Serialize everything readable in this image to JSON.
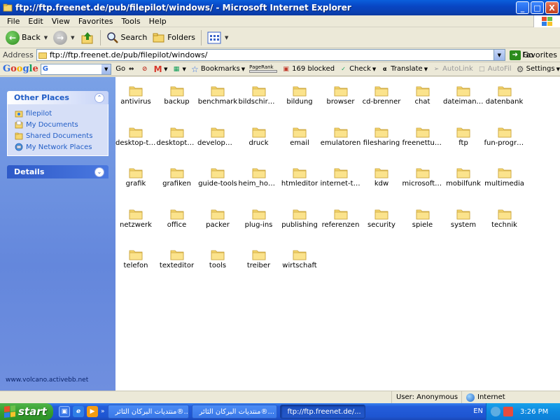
{
  "window": {
    "title": "ftp://ftp.freenet.de/pub/filepilot/windows/ - Microsoft Internet Explorer",
    "minimize": "_",
    "maximize": "□",
    "close": "X"
  },
  "menu": [
    "File",
    "Edit",
    "View",
    "Favorites",
    "Tools",
    "Help"
  ],
  "toolbar": {
    "back_label": "Back",
    "search_label": "Search",
    "folders_label": "Folders"
  },
  "address": {
    "label": "Address",
    "value": "ftp://ftp.freenet.de/pub/filepilot/windows/",
    "go_label": "Go",
    "favorites_label": "Favorites"
  },
  "google_toolbar": {
    "logo": "Google",
    "search_value": "G",
    "go_label": "Go",
    "mail_label": "M",
    "bookmarks_label": "Bookmarks",
    "pagerank_label": "PageRank",
    "blocked_label": "169 blocked",
    "check_label": "Check",
    "translate_label": "Translate",
    "autolink_label": "AutoLink",
    "autofill_label": "AutoFil",
    "settings_label": "Settings"
  },
  "sidebar": {
    "other_places": {
      "title": "Other Places",
      "items": [
        "filepilot",
        "My Documents",
        "Shared Documents",
        "My Network Places"
      ]
    },
    "details": {
      "title": "Details"
    },
    "watermark": "www.volcano.activebb.net"
  },
  "folders": [
    "antivirus",
    "backup",
    "benchmark",
    "bildschirmsc...",
    "bildung",
    "browser",
    "cd-brenner",
    "chat",
    "dateimanag...",
    "datenbank",
    "desktop-th...",
    "desktoptools",
    "development",
    "druck",
    "email",
    "emulatoren",
    "filesharing",
    "freenettuto...",
    "ftp",
    "fun-progra...",
    "grafik",
    "grafiken",
    "guide-tools",
    "heim_hobby",
    "htmleditor",
    "internet-tools",
    "kdw",
    "microsoftad...",
    "mobilfunk",
    "multimedia",
    "netzwerk",
    "office",
    "packer",
    "plug-ins",
    "publishing",
    "referenzen",
    "security",
    "spiele",
    "system",
    "technik",
    "telefon",
    "texteditor",
    "tools",
    "treiber",
    "wirtschaft"
  ],
  "status": {
    "user": "User: Anonymous",
    "zone": "Internet"
  },
  "taskbar": {
    "start_label": "start",
    "more": "»",
    "buttons": [
      "منتديات البركان الثائر®...",
      "منتديات البركان الثائر®...",
      "ftp://ftp.freenet.de/..."
    ],
    "language": "EN",
    "clock": "3:26 PM"
  },
  "colors": {
    "titlebar": "#0846c4",
    "taskpane": "#6487dc",
    "folder": "#f5d66e",
    "start": "#379f2f"
  }
}
